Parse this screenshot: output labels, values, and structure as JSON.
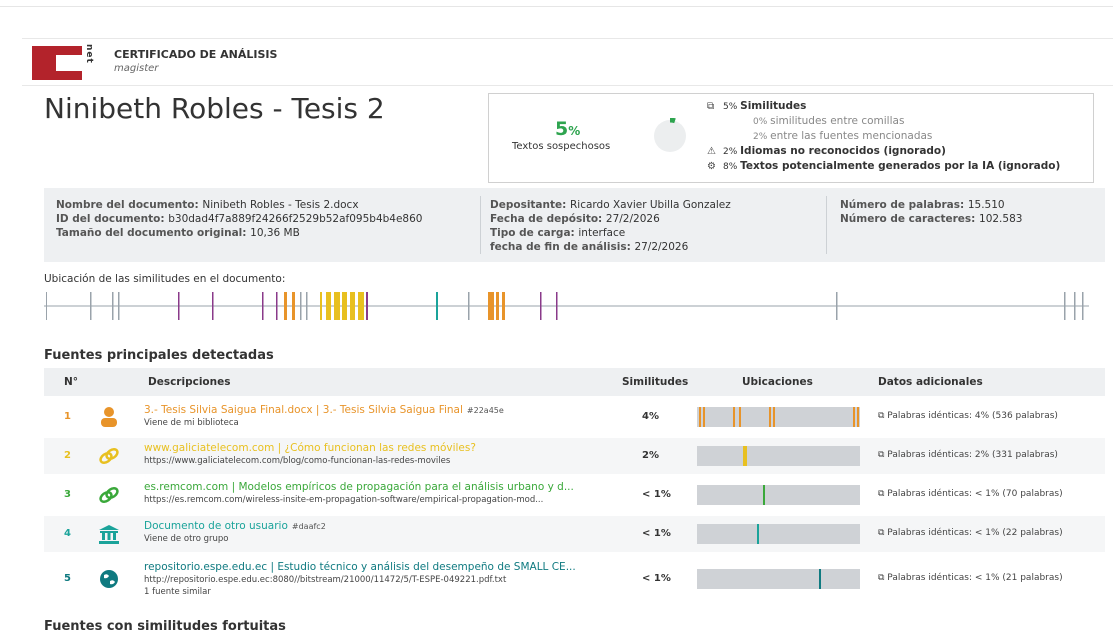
{
  "header": {
    "title": "CERTIFICADO DE ANÁLISIS",
    "subtitle": "magister",
    "logo_text": "net"
  },
  "document_title": "Ninibeth Robles - Tesis 2",
  "summary": {
    "percent": "5",
    "percent_sign": "%",
    "label": "Textos sospechosos",
    "lines": [
      {
        "icon": "similarity-icon",
        "pct": "5%",
        "text": "Similitudes",
        "sub": false
      },
      {
        "icon": "",
        "pct": "0%",
        "text": "similitudes entre comillas",
        "sub": true
      },
      {
        "icon": "",
        "pct": "2%",
        "text": "entre las fuentes mencionadas",
        "sub": true
      },
      {
        "icon": "warning-icon",
        "pct": "2%",
        "text": "Idiomas no reconocidos (ignorado)",
        "sub": false
      },
      {
        "icon": "ai-icon",
        "pct": "8%",
        "text": "Textos potencialmente generados por la IA (ignorado)",
        "sub": false
      }
    ]
  },
  "meta": {
    "col1": [
      {
        "k": "Nombre del documento:",
        "v": "Ninibeth Robles - Tesis 2.docx"
      },
      {
        "k": "ID del documento:",
        "v": "b30dad4f7a889f24266f2529b52af095b4b4e860"
      },
      {
        "k": "Tamaño del documento original:",
        "v": "10,36 MB"
      }
    ],
    "col2": [
      {
        "k": "Depositante:",
        "v": "Ricardo Xavier Ubilla Gonzalez"
      },
      {
        "k": "Fecha de depósito:",
        "v": "27/2/2026"
      },
      {
        "k": "Tipo de carga:",
        "v": "interface"
      },
      {
        "k": "fecha de fin de análisis:",
        "v": "27/2/2026"
      }
    ],
    "col3": [
      {
        "k": "Número de palabras:",
        "v": "15.510"
      },
      {
        "k": "Número de caracteres:",
        "v": "102.583"
      }
    ]
  },
  "locations_title": "Ubicación de las similitudes en el documento:",
  "sources_title": "Fuentes principales detectadas",
  "table_headers": {
    "num": "N°",
    "desc": "Descripciones",
    "sim": "Similitudes",
    "loc": "Ubicaciones",
    "extra": "Datos adicionales"
  },
  "sources": [
    {
      "num": "1",
      "color": "#e8942a",
      "icon": "user-icon",
      "title": "3.- Tesis Silvia Saigua Final.docx | 3.- Tesis Silvia Saigua Final",
      "tag": "#22a45e",
      "line2": "Viene de mi biblioteca",
      "line3": "",
      "sim": "4%",
      "extra": "Palabras idénticas: 4% (536 palabras)"
    },
    {
      "num": "2",
      "color": "#e8c020",
      "icon": "link-icon",
      "title": "www.galiciatelecom.com | ¿Cómo funcionan las redes móviles?",
      "tag": "",
      "line2": "https://www.galiciatelecom.com/blog/como-funcionan-las-redes-moviles",
      "line3": "",
      "sim": "2%",
      "extra": "Palabras idénticas: 2% (331 palabras)"
    },
    {
      "num": "3",
      "color": "#3aa83a",
      "icon": "link-icon",
      "title": "es.remcom.com | Modelos empíricos de propagación para el análisis urbano y d...",
      "tag": "",
      "line2": "https://es.remcom.com/wireless-insite-em-propagation-software/empirical-propagation-mod...",
      "line3": "",
      "sim": "< 1%",
      "extra": "Palabras idénticas: < 1% (70 palabras)"
    },
    {
      "num": "4",
      "color": "#1aa39a",
      "icon": "institution-icon",
      "title": "Documento de otro usuario",
      "tag": "#daafc2",
      "line2": "Viene de otro grupo",
      "line3": "",
      "sim": "< 1%",
      "extra": "Palabras idénticas: < 1% (22 palabras)"
    },
    {
      "num": "5",
      "color": "#0f7a80",
      "icon": "globe-icon",
      "title": "repositorio.espe.edu.ec | Estudio técnico y análisis del desempeño de SMALL CE...",
      "tag": "",
      "line2": "http://repositorio.espe.edu.ec:8080//bitstream/21000/11472/5/T-ESPE-049221.pdf.txt",
      "line3": "1 fuente similar",
      "sim": "< 1%",
      "extra": "Palabras idénticas: < 1% (21 palabras)"
    }
  ],
  "fortuitous_title": "Fuentes con similitudes fortuitas"
}
